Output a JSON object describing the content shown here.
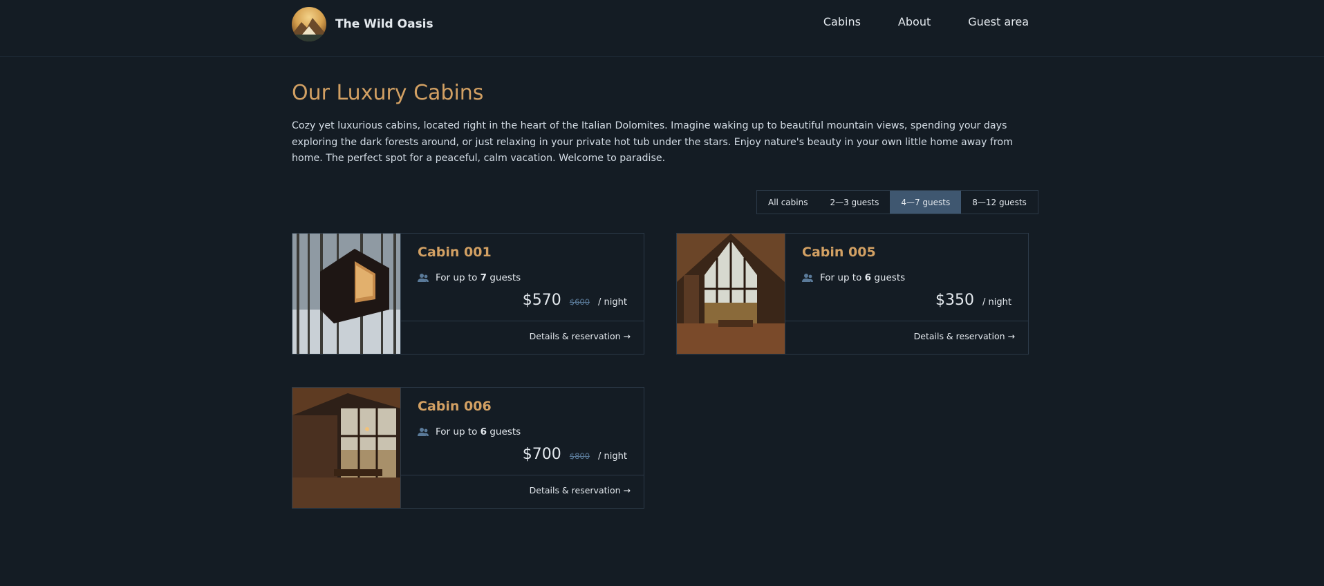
{
  "header": {
    "logo_text": "The Wild Oasis",
    "nav": [
      "Cabins",
      "About",
      "Guest area"
    ]
  },
  "page": {
    "title": "Our Luxury Cabins",
    "intro": "Cozy yet luxurious cabins, located right in the heart of the Italian Dolomites. Imagine waking up to beautiful mountain views, spending your days exploring the dark forests around, or just relaxing in your private hot tub under the stars. Enjoy nature's beauty in your own little home away from home. The perfect spot for a peaceful, calm vacation. Welcome to paradise."
  },
  "filter": {
    "options": [
      "All cabins",
      "2—3 guests",
      "4—7 guests",
      "8—12 guests"
    ],
    "active": "4—7 guests"
  },
  "cabins": [
    {
      "name": "Cabin 001",
      "guests_prefix": "For up to",
      "guests": "7",
      "guests_suffix": "guests",
      "price": "$570",
      "old_price": "$600",
      "per_night": "/ night",
      "link": "Details & reservation →"
    },
    {
      "name": "Cabin 005",
      "guests_prefix": "For up to",
      "guests": "6",
      "guests_suffix": "guests",
      "price": "$350",
      "old_price": "",
      "per_night": "/ night",
      "link": "Details & reservation →"
    },
    {
      "name": "Cabin 006",
      "guests_prefix": "For up to",
      "guests": "6",
      "guests_suffix": "guests",
      "price": "$700",
      "old_price": "$800",
      "per_night": "/ night",
      "link": "Details & reservation →"
    }
  ],
  "colors": {
    "background": "#141c24",
    "accent": "#d2a063",
    "active_filter": "#3f5770",
    "border": "#2c3a48"
  }
}
